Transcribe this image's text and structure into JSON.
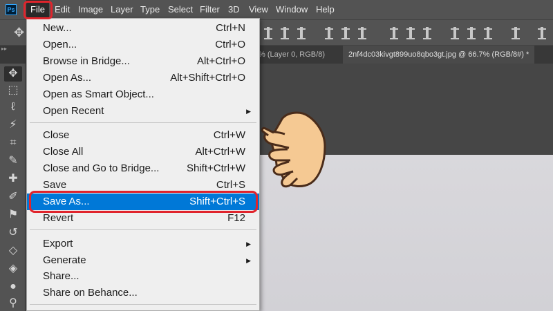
{
  "app": {
    "logo_text": "Ps",
    "accent": "#31a8ff"
  },
  "menubar": {
    "items": [
      "File",
      "Edit",
      "Image",
      "Layer",
      "Type",
      "Select",
      "Filter",
      "3D",
      "View",
      "Window",
      "Help"
    ],
    "active": "File"
  },
  "tabs": [
    {
      "label": "% (Layer 0, RGB/8)"
    },
    {
      "label": "2nf4dc03kivgt899uo8qbo3gt.jpg @ 66.7% (RGB/8#) *"
    }
  ],
  "file_menu": {
    "groups": [
      [
        {
          "label": "New...",
          "shortcut": "Ctrl+N"
        },
        {
          "label": "Open...",
          "shortcut": "Ctrl+O"
        },
        {
          "label": "Browse in Bridge...",
          "shortcut": "Alt+Ctrl+O"
        },
        {
          "label": "Open As...",
          "shortcut": "Alt+Shift+Ctrl+O"
        },
        {
          "label": "Open as Smart Object...",
          "shortcut": ""
        },
        {
          "label": "Open Recent",
          "shortcut": "",
          "submenu": true
        }
      ],
      [
        {
          "label": "Close",
          "shortcut": "Ctrl+W"
        },
        {
          "label": "Close All",
          "shortcut": "Alt+Ctrl+W"
        },
        {
          "label": "Close and Go to Bridge...",
          "shortcut": "Shift+Ctrl+W"
        },
        {
          "label": "Save",
          "shortcut": "Ctrl+S"
        },
        {
          "label": "Save As...",
          "shortcut": "Shift+Ctrl+S",
          "highlighted": true
        },
        {
          "label": "Revert",
          "shortcut": "F12"
        }
      ],
      [
        {
          "label": "Export",
          "shortcut": "",
          "submenu": true
        },
        {
          "label": "Generate",
          "shortcut": "",
          "submenu": true
        },
        {
          "label": "Share...",
          "shortcut": ""
        },
        {
          "label": "Share on Behance...",
          "shortcut": ""
        }
      ]
    ]
  },
  "colors": {
    "highlight": "#0078d7",
    "annotation": "#e0242c",
    "hand_fill": "#f5c993"
  },
  "icons": {
    "submenu": "submenu-arrow-icon",
    "toolbar": [
      "move-icon",
      "marquee-icon",
      "lasso-icon",
      "magic-wand-icon",
      "crop-icon",
      "eyedropper-icon",
      "healing-brush-icon",
      "brush-icon",
      "clone-stamp-icon",
      "history-brush-icon",
      "eraser-icon",
      "paint-bucket-icon",
      "blur-icon",
      "dodge-icon"
    ]
  }
}
